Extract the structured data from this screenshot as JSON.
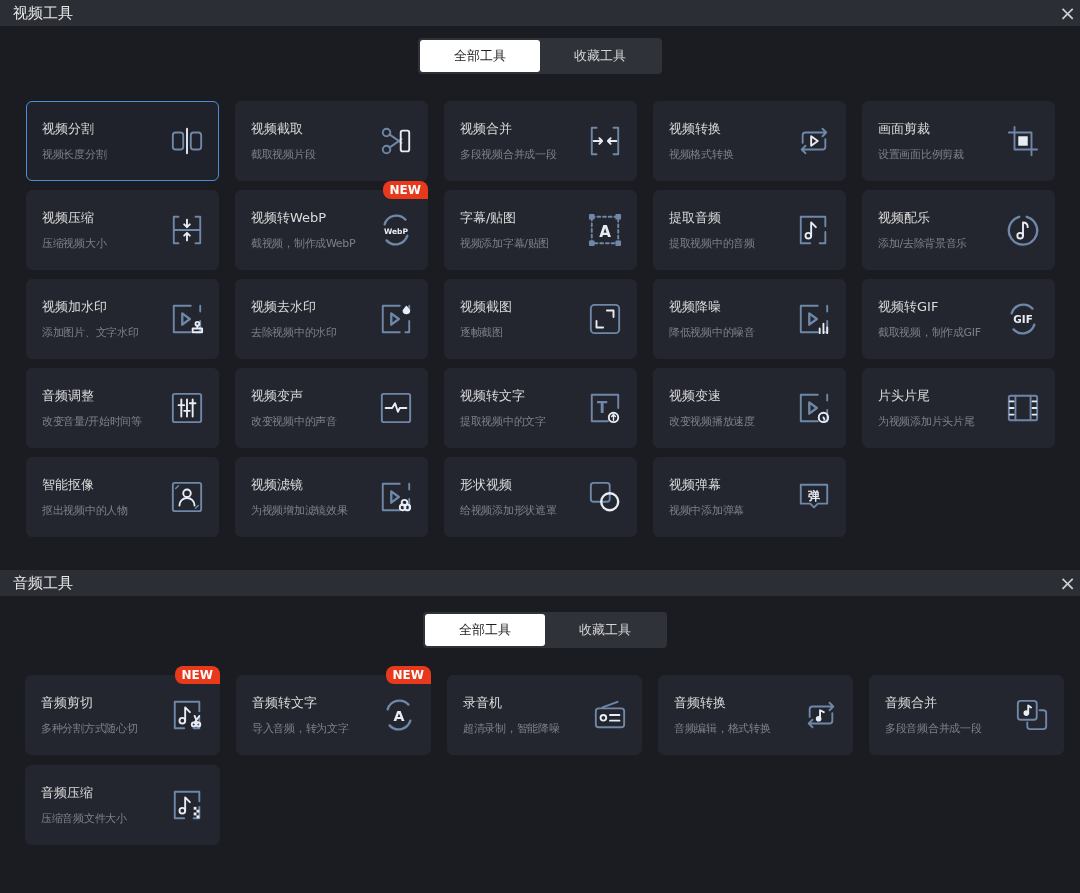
{
  "sections": [
    {
      "title": "视频工具",
      "close": "×",
      "tabs": [
        {
          "label": "全部工具",
          "selected": true
        },
        {
          "label": "收藏工具",
          "selected": false
        }
      ],
      "cards": [
        {
          "title": "视频分割",
          "subtitle": "视频长度分割",
          "selected": true
        },
        {
          "title": "视频截取",
          "subtitle": "截取视频片段",
          "selected": false
        },
        {
          "title": "视频合并",
          "subtitle": "多段视频合并成一段",
          "selected": false
        },
        {
          "title": "视频转换",
          "subtitle": "视频格式转换",
          "selected": false
        },
        {
          "title": "画面剪裁",
          "subtitle": "设置画面比例剪裁",
          "selected": false
        },
        {
          "title": "视频压缩",
          "subtitle": "压缩视频大小",
          "selected": false
        },
        {
          "title": "视频转WebP",
          "subtitle": "截视频，制作成WebP",
          "selected": false,
          "badge": "NEW",
          "icon_text": "WebP"
        },
        {
          "title": "字幕/贴图",
          "subtitle": "视频添加字幕/贴图",
          "selected": false,
          "icon_text": "A"
        },
        {
          "title": "提取音频",
          "subtitle": "提取视频中的音频",
          "selected": false
        },
        {
          "title": "视频配乐",
          "subtitle": "添加/去除背景音乐",
          "selected": false
        },
        {
          "title": "视频加水印",
          "subtitle": "添加图片、文字水印",
          "selected": false
        },
        {
          "title": "视频去水印",
          "subtitle": "去除视频中的水印",
          "selected": false
        },
        {
          "title": "视频截图",
          "subtitle": "逐帧截图",
          "selected": false
        },
        {
          "title": "视频降噪",
          "subtitle": "降低视频中的噪音",
          "selected": false
        },
        {
          "title": "视频转GIF",
          "subtitle": "截取视频，制作成GIF",
          "selected": false,
          "icon_text": "GIF"
        },
        {
          "title": "音频调整",
          "subtitle": "改变音量/开始时间等",
          "selected": false
        },
        {
          "title": "视频变声",
          "subtitle": "改变视频中的声音",
          "selected": false
        },
        {
          "title": "视频转文字",
          "subtitle": "提取视频中的文字",
          "selected": false,
          "icon_text": "T"
        },
        {
          "title": "视频变速",
          "subtitle": "改变视频播放速度",
          "selected": false
        },
        {
          "title": "片头片尾",
          "subtitle": "为视频添加片头片尾",
          "selected": false
        },
        {
          "title": "智能抠像",
          "subtitle": "抠出视频中的人物",
          "selected": false
        },
        {
          "title": "视频滤镜",
          "subtitle": "为视频增加滤镜效果",
          "selected": false
        },
        {
          "title": "形状视频",
          "subtitle": "给视频添加形状遮罩",
          "selected": false
        },
        {
          "title": "视频弹幕",
          "subtitle": "视频中添加弹幕",
          "selected": false,
          "icon_text": "弹"
        }
      ]
    },
    {
      "title": "音频工具",
      "close": "×",
      "tabs": [
        {
          "label": "全部工具",
          "selected": true
        },
        {
          "label": "收藏工具",
          "selected": false
        }
      ],
      "cards": [
        {
          "title": "音频剪切",
          "subtitle": "多种分割方式随心切",
          "selected": false,
          "badge": "NEW"
        },
        {
          "title": "音频转文字",
          "subtitle": "导入音频，转为文字",
          "selected": false,
          "badge": "NEW",
          "icon_text": "A"
        },
        {
          "title": "录音机",
          "subtitle": "超清录制，智能降噪",
          "selected": false
        },
        {
          "title": "音频转换",
          "subtitle": "音频编辑，格式转换",
          "selected": false
        },
        {
          "title": "音频合并",
          "subtitle": "多段音频合并成一段",
          "selected": false
        },
        {
          "title": "音频压缩",
          "subtitle": "压缩音频文件大小",
          "selected": false
        }
      ]
    }
  ]
}
